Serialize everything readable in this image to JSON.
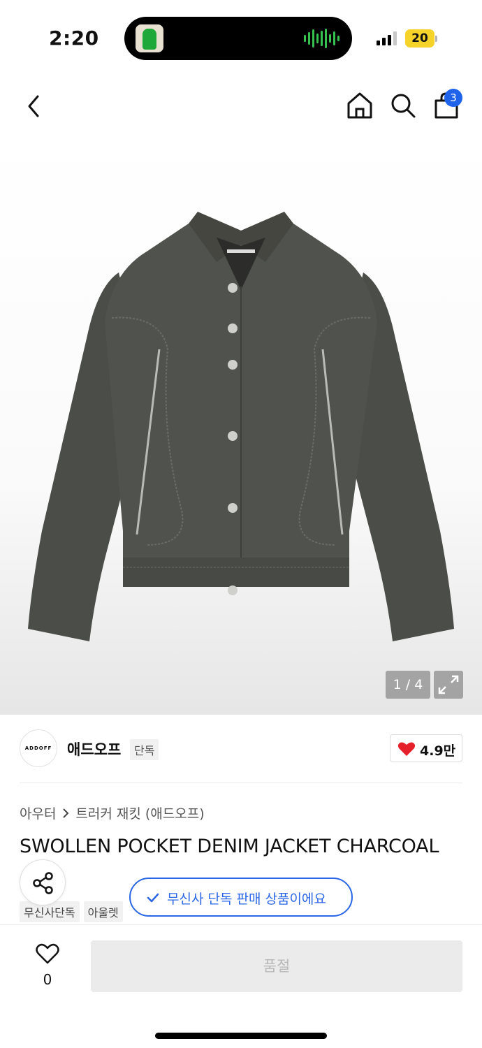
{
  "status_bar": {
    "time": "2:20",
    "battery": "20"
  },
  "nav": {
    "back_icon": "chevron-left-icon",
    "home_icon": "home-icon",
    "search_icon": "search-icon",
    "cart_icon": "shopping-bag-icon",
    "cart_count": "3"
  },
  "gallery": {
    "counter": "1 / 4",
    "expand_icon": "expand-icon"
  },
  "brand": {
    "logo_text": "ADDOFF",
    "name": "애드오프",
    "tag": "단독",
    "like_count": "4.9만",
    "like_color": "#e5202a"
  },
  "breadcrumb": {
    "category": "아우터",
    "subcategory": "트러커 재킷 (애드오프)"
  },
  "product": {
    "title": "SWOLLEN POCKET DENIM JACKET CHARCOAL"
  },
  "tags": [
    "무신사단독",
    "아울렛"
  ],
  "exclusive_notice": {
    "text": "무신사 단독 판매 상품이에요",
    "color": "#2a66e6"
  },
  "bottom_bar": {
    "wish_count": "0",
    "cta_label": "품절"
  }
}
